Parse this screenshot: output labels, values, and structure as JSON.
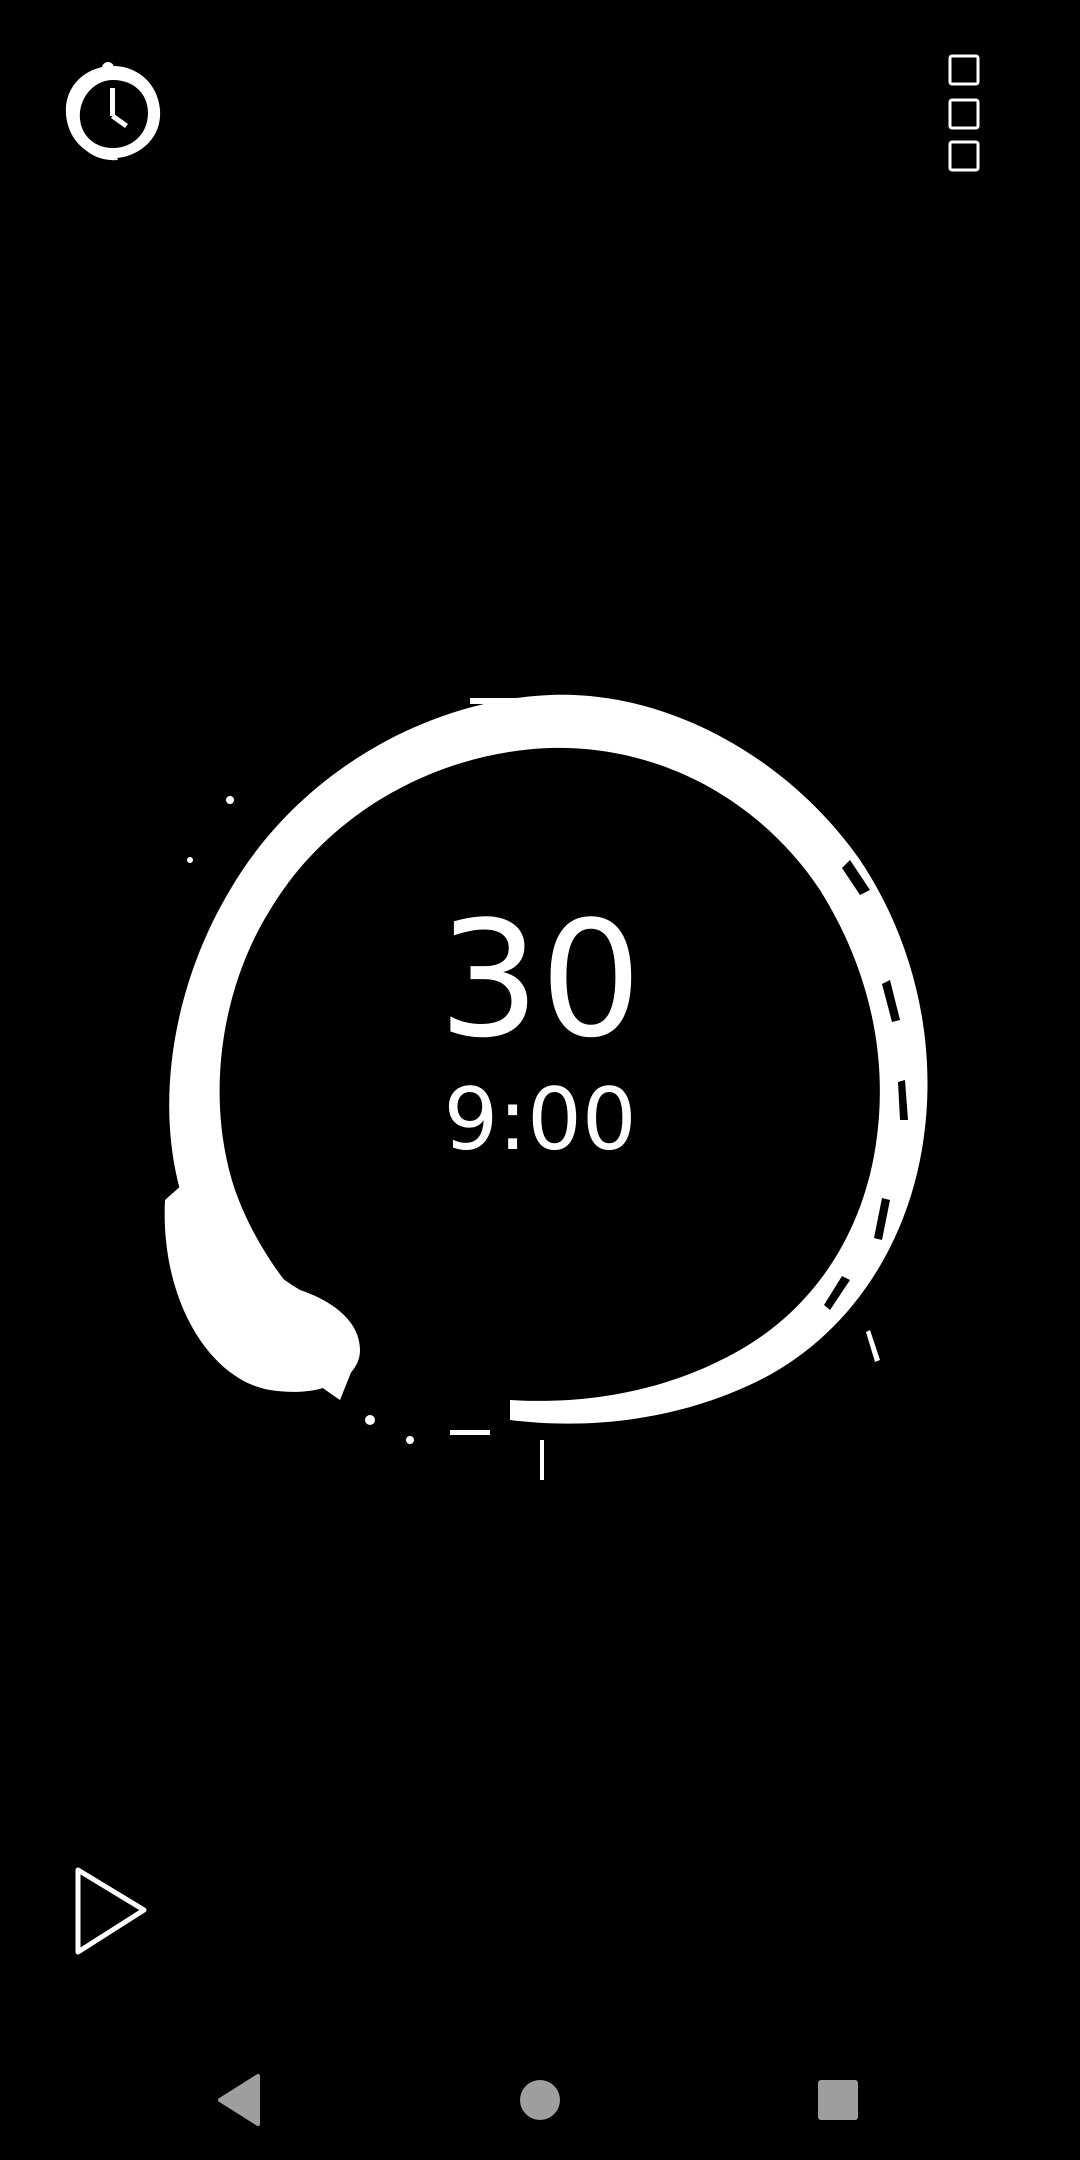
{
  "timer": {
    "count": "30",
    "time": "9:00"
  },
  "icons": {
    "timer_settings": "timer-clock-icon",
    "menu": "menu-squares-icon",
    "play": "play-icon",
    "nav_back": "back-triangle-icon",
    "nav_home": "home-circle-icon",
    "nav_recents": "recents-square-icon"
  },
  "colors": {
    "background": "#000000",
    "foreground": "#ffffff",
    "nav": "#9e9e9e"
  }
}
